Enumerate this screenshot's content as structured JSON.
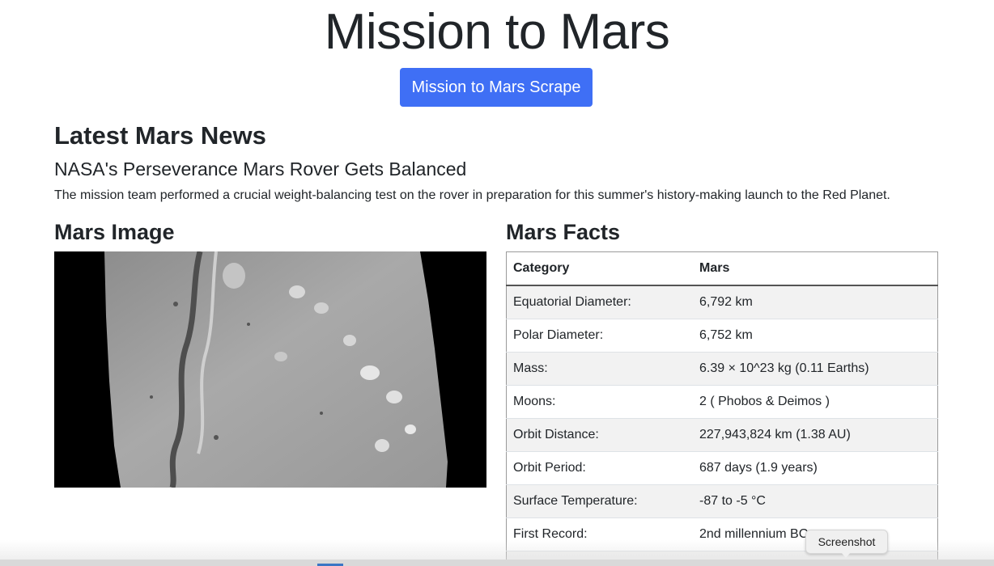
{
  "page": {
    "title": "Mission to Mars",
    "scrape_button": "Mission to Mars Scrape"
  },
  "news": {
    "heading": "Latest Mars News",
    "title": "NASA's Perseverance Mars Rover Gets Balanced",
    "paragraph": "The mission team performed a crucial weight-balancing test on the rover in preparation for this summer's history-making launch to the Red Planet."
  },
  "image_section": {
    "heading": "Mars Image"
  },
  "facts": {
    "heading": "Mars Facts",
    "columns": [
      "Category",
      "Mars"
    ],
    "rows": [
      [
        "Equatorial Diameter:",
        "6,792 km"
      ],
      [
        "Polar Diameter:",
        "6,752 km"
      ],
      [
        "Mass:",
        "6.39 × 10^23 kg (0.11 Earths)"
      ],
      [
        "Moons:",
        "2 ( Phobos & Deimos )"
      ],
      [
        "Orbit Distance:",
        "227,943,824 km (1.38 AU)"
      ],
      [
        "Orbit Period:",
        "687 days (1.9 years)"
      ],
      [
        "Surface Temperature:",
        "-87 to -5 °C"
      ],
      [
        "First Record:",
        "2nd millennium BC"
      ],
      [
        "",
        ""
      ]
    ]
  },
  "tooltip": {
    "label": "Screenshot"
  },
  "colors": {
    "button": "#3f6ff5",
    "stripe": "#f2f2f2"
  }
}
